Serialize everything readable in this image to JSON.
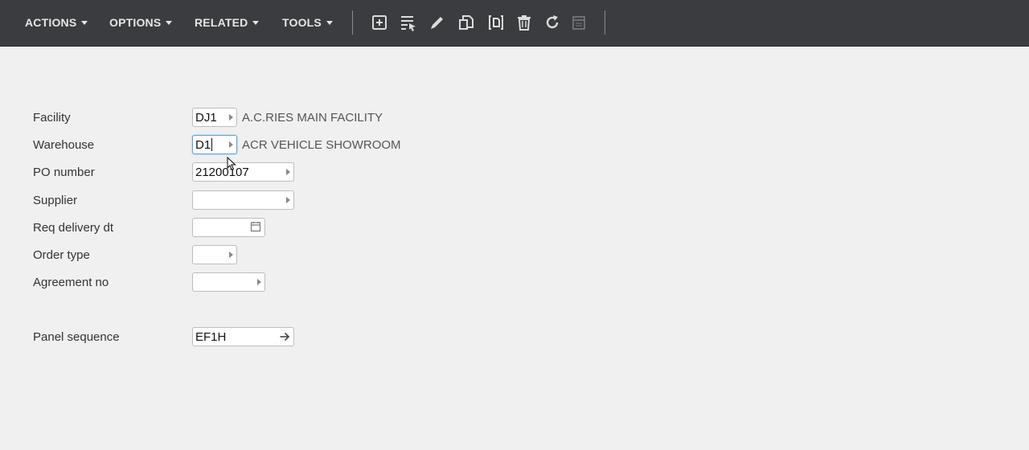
{
  "toolbar": {
    "menus": [
      {
        "label": "ACTIONS"
      },
      {
        "label": "OPTIONS"
      },
      {
        "label": "RELATED"
      },
      {
        "label": "TOOLS"
      }
    ],
    "icons": [
      "new-icon",
      "select-icon",
      "edit-icon",
      "copy-icon",
      "display-icon",
      "delete-icon",
      "refresh-icon",
      "calendar-icon"
    ]
  },
  "form": {
    "facility": {
      "label": "Facility",
      "value": "DJ1",
      "description": "A.C.RIES MAIN FACILITY"
    },
    "warehouse": {
      "label": "Warehouse",
      "value": "D1",
      "description": "ACR VEHICLE SHOWROOM"
    },
    "po_number": {
      "label": "PO number",
      "value": "21200107"
    },
    "supplier": {
      "label": "Supplier",
      "value": ""
    },
    "req_delivery_dt": {
      "label": "Req delivery dt",
      "value": ""
    },
    "order_type": {
      "label": "Order type",
      "value": ""
    },
    "agreement_no": {
      "label": "Agreement no",
      "value": ""
    },
    "panel_sequence": {
      "label": "Panel sequence",
      "value": "EF1H"
    }
  },
  "colors": {
    "toolbar_bg": "#3b3c3f",
    "page_bg": "#f0f0f0",
    "focus_border": "#5aa4dc"
  }
}
